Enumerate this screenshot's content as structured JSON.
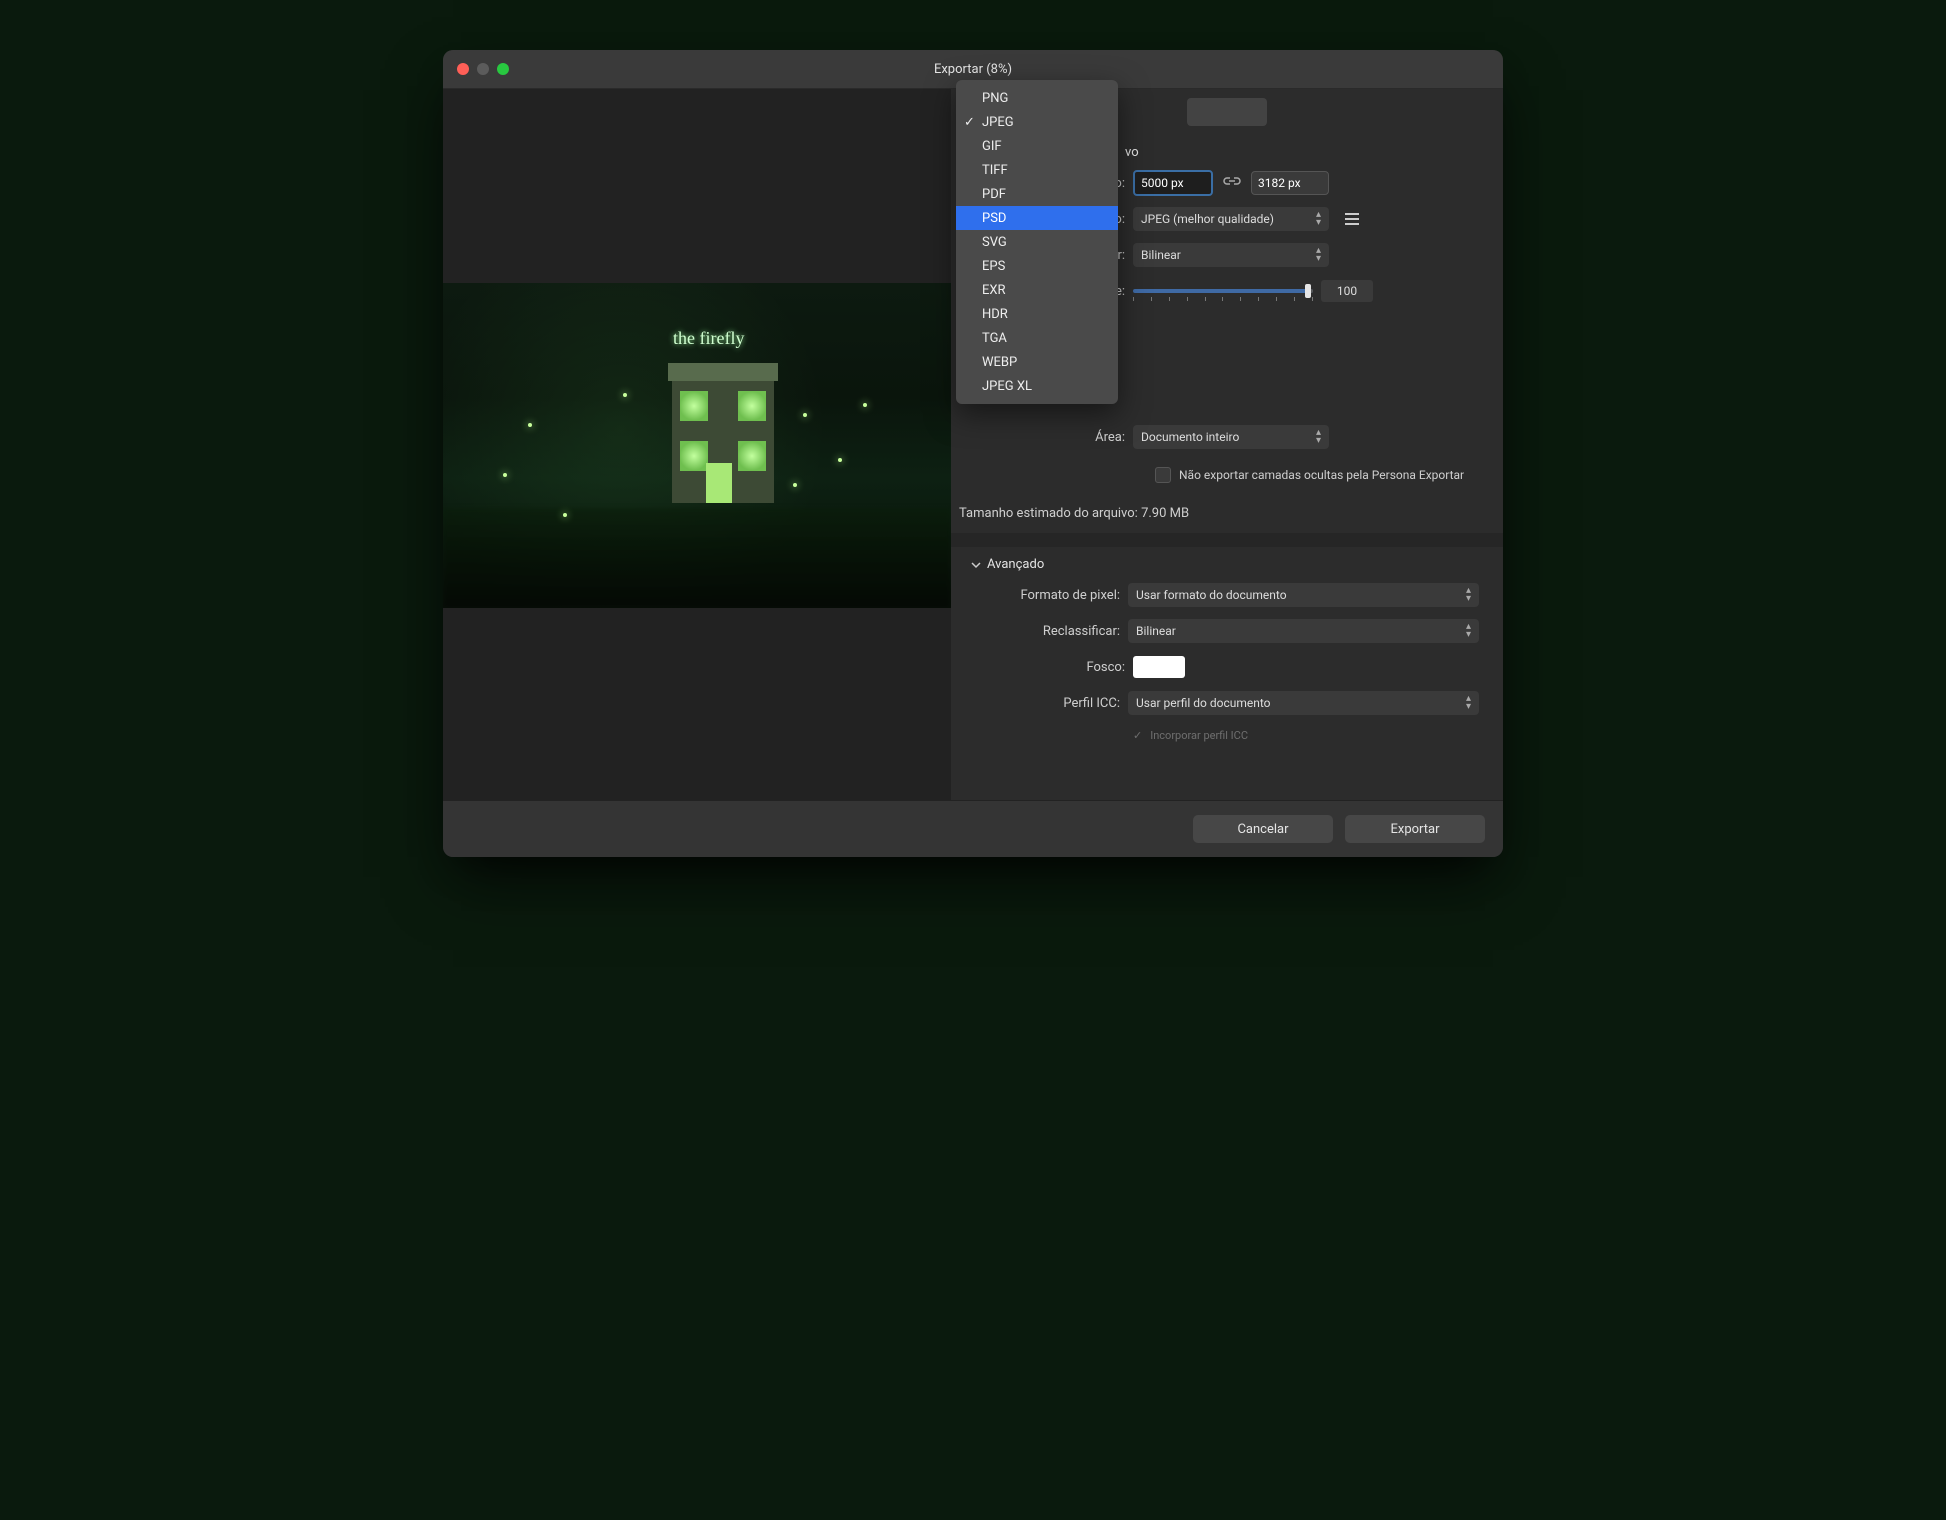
{
  "title": "Exportar (8%)",
  "preview_sign": "the firefly",
  "formats": [
    "PNG",
    "JPEG",
    "GIF",
    "TIFF",
    "PDF",
    "PSD",
    "SVG",
    "EPS",
    "EXR",
    "HDR",
    "TGA",
    "WEBP",
    "JPEG XL"
  ],
  "format_checked": "JPEG",
  "format_highlighted": "PSD",
  "file_section_title_fragment": "vo",
  "labels": {
    "size": "nho:",
    "preset": "ção:",
    "resample": "rar:",
    "quality": "ade:",
    "area": "Área:",
    "advanced": "Avançado",
    "pixel_format": "Formato de pixel:",
    "reclassify": "Reclassificar:",
    "matte": "Fosco:",
    "icc": "Perfil ICC:"
  },
  "values": {
    "width": "5000 px",
    "height": "3182 px",
    "preset": "JPEG (melhor qualidade)",
    "resample": "Bilinear",
    "quality": "100",
    "area": "Documento inteiro",
    "hidden_layers": "Não exportar camadas ocultas pela Persona Exportar",
    "estimate_label": "Tamanho estimado do arquivo:",
    "estimate_value": "7.90 MB",
    "pixel_format": "Usar formato do documento",
    "reclassify": "Bilinear",
    "icc": "Usar perfil do documento",
    "embed_icc_fragment": "Incorporar perfil ICC"
  },
  "buttons": {
    "cancel": "Cancelar",
    "export": "Exportar"
  }
}
